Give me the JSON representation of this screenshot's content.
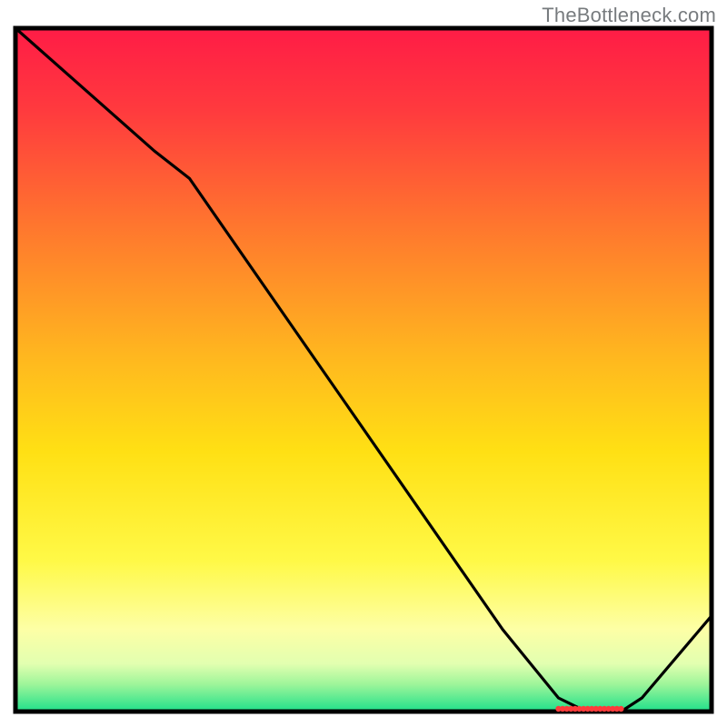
{
  "watermark": "TheBottleneck.com",
  "chart_data": {
    "type": "line",
    "xlabel": "",
    "ylabel": "",
    "xlim": [
      0,
      100
    ],
    "ylim": [
      0,
      100
    ],
    "grid": false,
    "background_gradient": {
      "stops": [
        {
          "pct": 0,
          "color": "#ff1c46"
        },
        {
          "pct": 12,
          "color": "#ff3a3e"
        },
        {
          "pct": 30,
          "color": "#ff7a2d"
        },
        {
          "pct": 48,
          "color": "#ffb71f"
        },
        {
          "pct": 62,
          "color": "#ffe014"
        },
        {
          "pct": 78,
          "color": "#fff947"
        },
        {
          "pct": 88,
          "color": "#fdffa6"
        },
        {
          "pct": 93,
          "color": "#e2ffb0"
        },
        {
          "pct": 96,
          "color": "#9ef59a"
        },
        {
          "pct": 100,
          "color": "#1fe08a"
        }
      ]
    },
    "series": [
      {
        "name": "curve",
        "color": "#000000",
        "x": [
          0,
          10,
          20,
          25,
          40,
          55,
          70,
          78,
          82,
          87,
          90,
          100
        ],
        "y": [
          100,
          91,
          82,
          78,
          56,
          34,
          12,
          2,
          0,
          0,
          2,
          14
        ]
      }
    ],
    "zero_marker": {
      "x_start": 78,
      "x_end": 87,
      "color": "#ff3b3b"
    }
  }
}
